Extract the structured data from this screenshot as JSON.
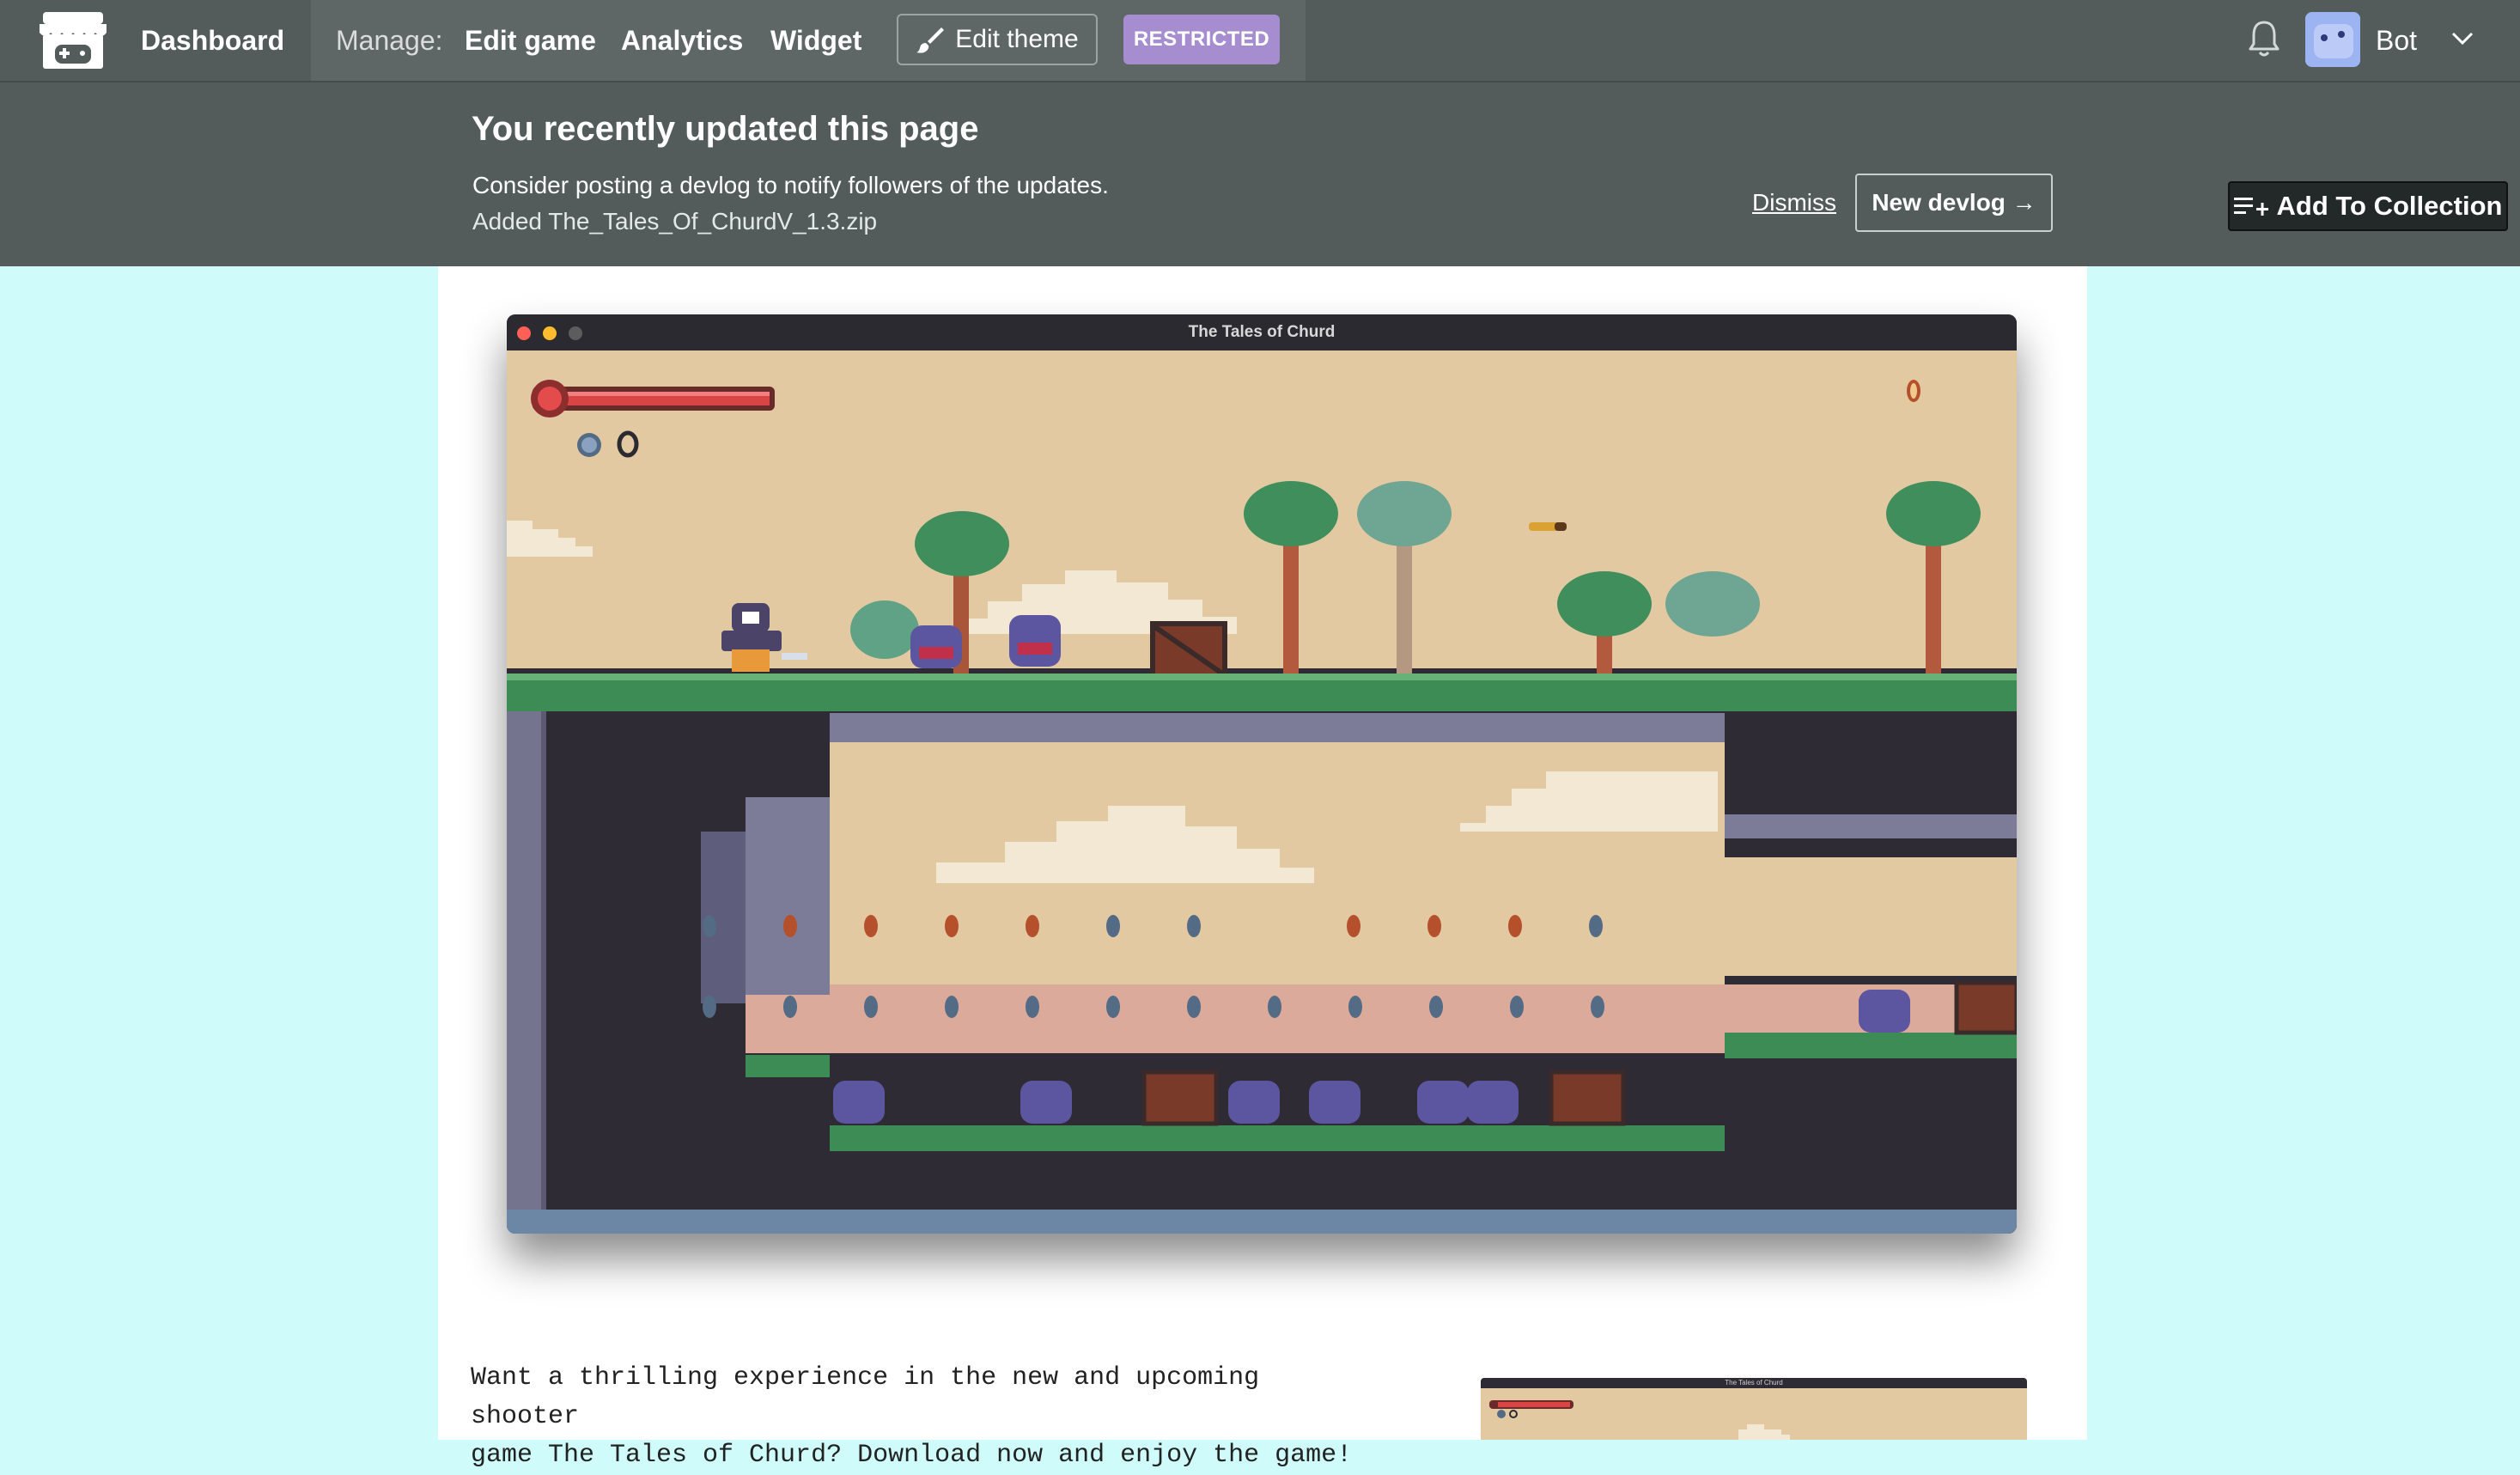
{
  "nav": {
    "dashboard": "Dashboard",
    "manage_label": "Manage:",
    "edit_game": "Edit game",
    "analytics": "Analytics",
    "widget": "Widget",
    "edit_theme": "Edit theme",
    "restricted": "RESTRICTED",
    "user_name": "Bot",
    "restricted_color": "#a58dd0"
  },
  "banner": {
    "title": "You recently updated this page",
    "message": "Consider posting a devlog to notify followers of the updates.",
    "file_note": "Added The_Tales_Of_ChurdV_1.3.zip",
    "dismiss": "Dismiss",
    "new_devlog": "New devlog →"
  },
  "add_to_collection": "Add To Collection",
  "screenshot": {
    "window_title": "The Tales of Churd"
  },
  "description": {
    "line1": "Want a thrilling experience in the new and upcoming shooter",
    "line2": "game The Tales of Churd? Download now and enjoy the game!"
  },
  "thumbnail": {
    "window_title": "The Tales of Churd"
  },
  "icons": {
    "logo": "itchio-store-logo-icon",
    "edit_theme": "paintbrush-icon",
    "notifications": "bell-icon",
    "user_menu": "chevron-down-icon",
    "collection": "playlist-add-icon"
  }
}
